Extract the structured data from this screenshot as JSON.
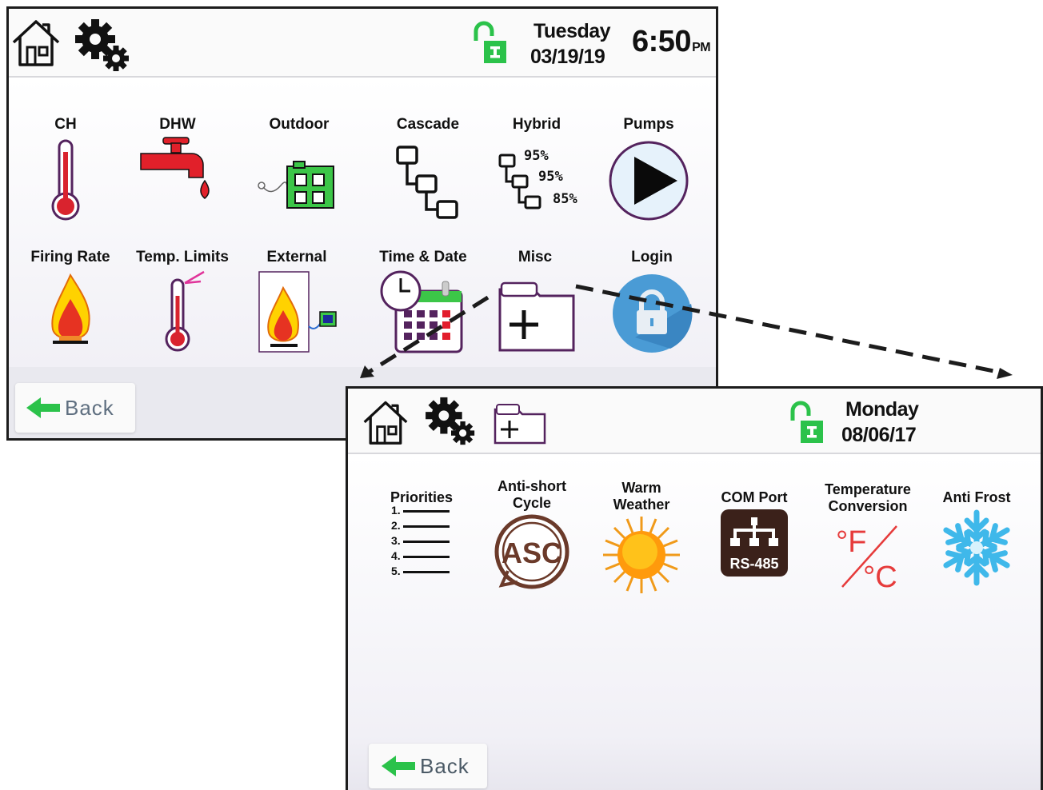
{
  "screen1": {
    "date": {
      "day": "Tuesday",
      "date": "03/19/19"
    },
    "clock": {
      "time": "6:50",
      "ampm": "PM"
    },
    "icons": {
      "home": "home-icon",
      "settings": "gear-icon",
      "lock": "unlock-icon"
    },
    "menu": {
      "row1": [
        "CH",
        "DHW",
        "Outdoor",
        "Cascade",
        "Hybrid",
        "Pumps"
      ],
      "row2": [
        "Firing Rate",
        "Temp. Limits",
        "External",
        "Time & Date",
        "Misc",
        "Login"
      ]
    },
    "hybrid_values": [
      "95%",
      "95%",
      "85%"
    ],
    "back_label": "Back"
  },
  "screen2": {
    "date": {
      "day": "Monday",
      "date": "08/06/17"
    },
    "icons": {
      "home": "home-icon",
      "settings": "gear-icon",
      "misc": "misc-folder-icon",
      "lock": "unlock-icon"
    },
    "menu": {
      "priorities": "Priorities",
      "anti_short_1": "Anti-short",
      "anti_short_2": "Cycle",
      "warm_1": "Warm",
      "warm_2": "Weather",
      "com_port": "COM Port",
      "temp_1": "Temperature",
      "temp_2": "Conversion",
      "anti_frost": "Anti Frost"
    },
    "priority_numbers": [
      "1.",
      "2.",
      "3.",
      "4.",
      "5."
    ],
    "asc_text": "ASC",
    "rs485_text": "RS-485",
    "deg_f": "°F",
    "deg_c": "°C",
    "back_label": "Back"
  },
  "colors": {
    "accent_green": "#2bc24a",
    "icon_purple": "#54235e",
    "flame_yellow": "#ffd200"
  }
}
